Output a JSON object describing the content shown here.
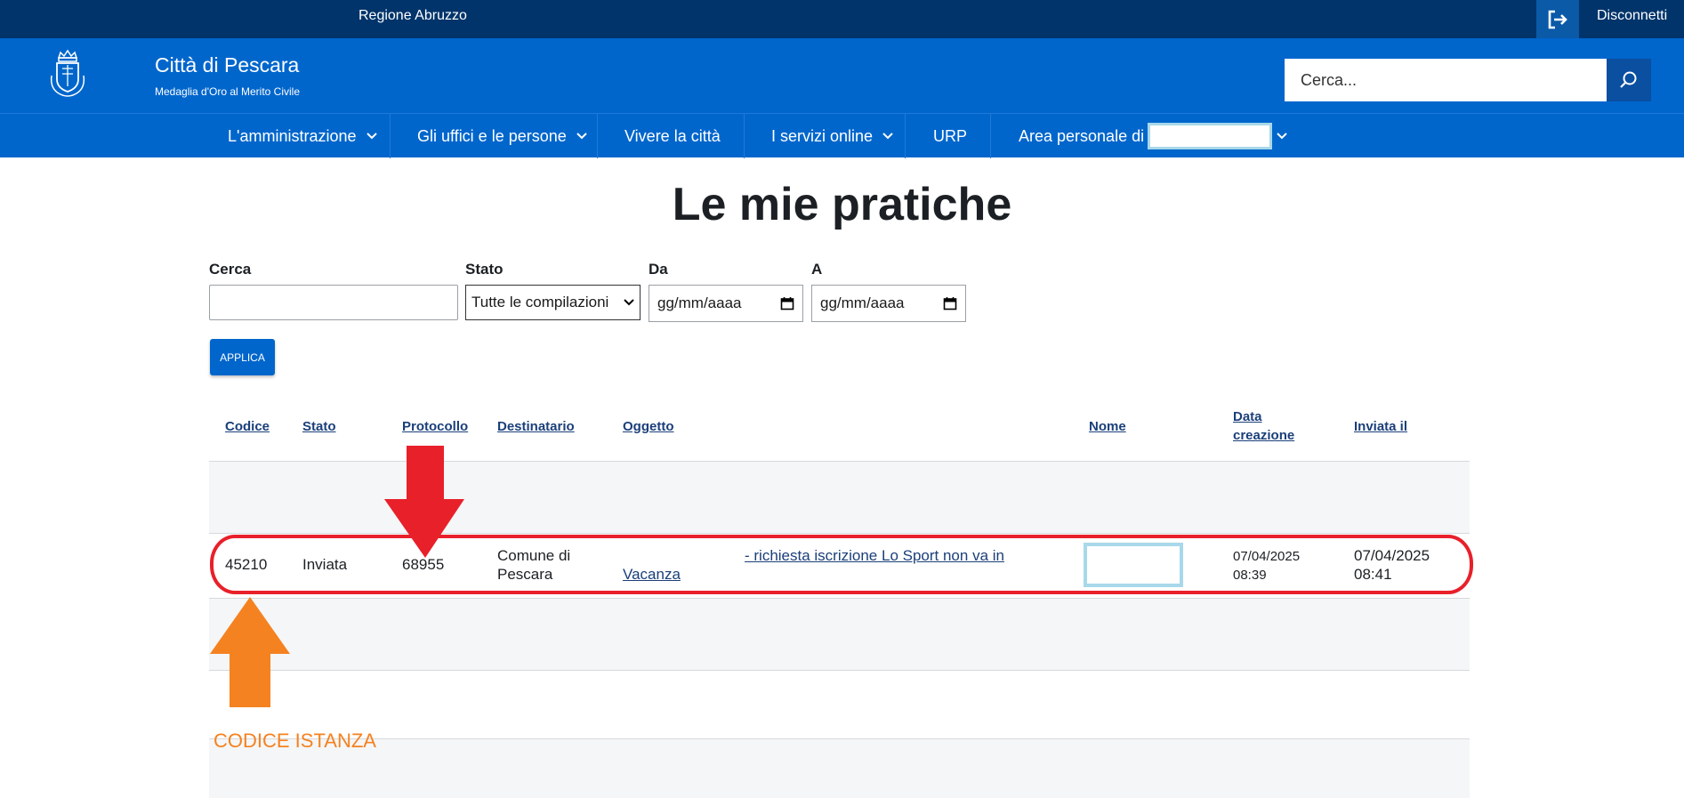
{
  "topbar": {
    "region": "Regione Abruzzo",
    "disconnect": "Disconnetti"
  },
  "header": {
    "city": "Città di Pescara",
    "motto": "Medaglia d'Oro al Merito Civile",
    "search_placeholder": "Cerca..."
  },
  "nav": {
    "items": [
      {
        "label": "L'amministrazione"
      },
      {
        "label": "Gli uffici e le persone"
      },
      {
        "label": "Vivere la città"
      },
      {
        "label": "I servizi online"
      },
      {
        "label": "URP"
      },
      {
        "label": "Area personale di"
      }
    ]
  },
  "page": {
    "title": "Le mie pratiche"
  },
  "filters": {
    "search_label": "Cerca",
    "status_label": "Stato",
    "status_value": "Tutte le compilazioni",
    "from_label": "Da",
    "from_placeholder": "gg/mm/aaaa",
    "to_label": "A",
    "to_placeholder": "gg/mm/aaaa",
    "apply_label": "APPLICA"
  },
  "table": {
    "headers": {
      "codice": "Codice",
      "stato": "Stato",
      "protocollo": "Protocollo",
      "destinatario": "Destinatario",
      "oggetto": "Oggetto",
      "nome": "Nome",
      "data_creazione_1": "Data",
      "data_creazione_2": "creazione",
      "inviata": "Inviata il"
    },
    "row": {
      "codice": "45210",
      "stato": "Inviata",
      "protocollo": "68955",
      "destinatario_1": "Comune di",
      "destinatario_2": "Pescara",
      "oggetto_1": "- richiesta iscrizione Lo Sport non va in",
      "oggetto_2": "Vacanza",
      "creazione_data": "07/04/2025",
      "creazione_ora": "08:39",
      "inviata_data": "07/04/2025",
      "inviata_ora": "08:41"
    }
  },
  "annotation": {
    "label": "CODICE ISTANZA",
    "colors": {
      "red": "#e8202a",
      "orange": "#f58220",
      "highlight": "#a8d8ea"
    }
  }
}
